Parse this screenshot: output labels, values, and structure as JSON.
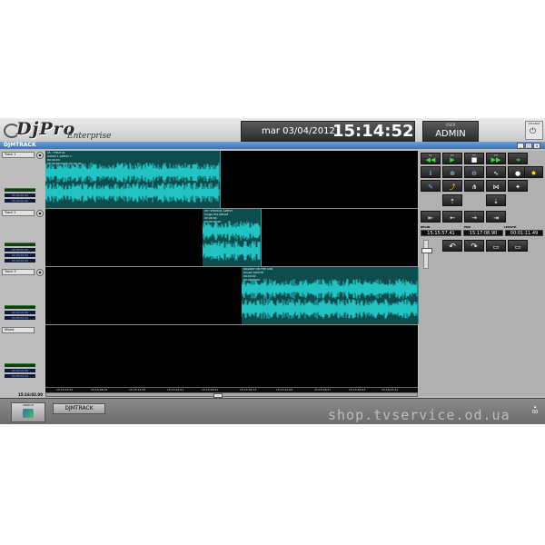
{
  "header": {
    "logo_brand": "DjPro",
    "logo_sub": "Enterprise",
    "date": "mar 03/04/2012",
    "time": "15:14:52",
    "user_label": "USER",
    "user_name": "ADMIN",
    "disable_label": "DISABLE"
  },
  "window": {
    "title": "DJMTRACK"
  },
  "tracks": [
    {
      "name": "Track 1",
      "meter_times": [
        "00:00:00.00",
        "00:00:00.00"
      ]
    },
    {
      "name": "Track 2",
      "meter_times": [
        "00:00:00.00",
        "00:00:00.00",
        "00:00:00.00"
      ]
    },
    {
      "name": "Track 3",
      "meter_times": [
        "00:00:00.00",
        "00:00:00.00"
      ]
    },
    {
      "name": "Mixed",
      "meter_times": [
        "00:00:00.00",
        "00:00:00.00"
      ]
    }
  ],
  "clips": [
    {
      "lines": [
        "01 - TITLE 01",
        "AUDIO 1  ARTIST 1",
        "00:00:00",
        "00:00:00.00 00:00:00.00"
      ]
    },
    {
      "lines": [
        "CH: STUDIO1 ARTIST",
        "Single Mix  JINGLE",
        "00:00:00",
        "00:00:00.00"
      ]
    },
    {
      "lines": [
        "WALKIN' ON THE SUN",
        "Smash MOUTH",
        "00:00:00",
        "00:00:00.00"
      ]
    }
  ],
  "ruler": {
    "ticks": [
      "15:15:03.34",
      "15:15:08.16",
      "15:15:14.35",
      "15:15:22.21",
      "15:15:28.21",
      "15:15:34.73",
      "15:15:42.06",
      "15:15:48.57",
      "15:15:55.53",
      "15:16:01.41",
      "15:17:02.33"
    ],
    "position_time": "15:16:02.00",
    "end_time": "15:13:6.11"
  },
  "controls": {
    "row1": [
      "F1",
      "F2",
      "F3",
      "F4"
    ],
    "begin_label": "BEGIN",
    "end_label": "END",
    "length_label": "LENGTH",
    "begin_value": "15:15:57.41",
    "end_value": "15:17:08.90",
    "length_value": "00:01:11.49"
  },
  "bottom": {
    "switch_label": "SWITCH",
    "module_tab": "DJMTRACK",
    "counter_top": "▴",
    "counter_value": "00"
  },
  "watermark": "shop.tvservice.od.ua"
}
